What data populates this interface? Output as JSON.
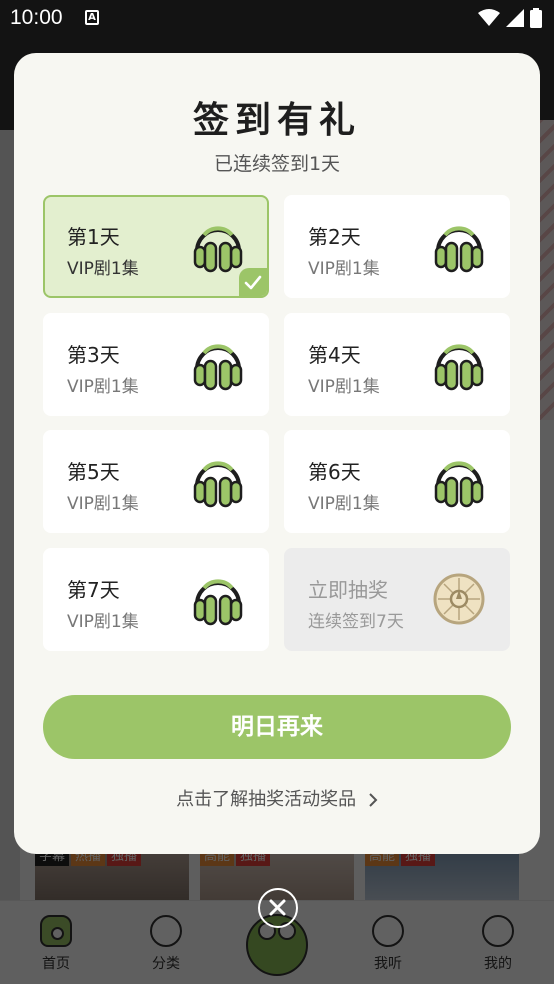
{
  "status_bar": {
    "time": "10:00",
    "notification_icon": "a-box-icon",
    "icons": [
      "wifi-icon",
      "signal-icon",
      "battery-icon"
    ]
  },
  "background": {
    "posters": [
      {
        "tags": [
          "字幕",
          "热播",
          "独播"
        ]
      },
      {
        "tags": [
          "高能",
          "独播"
        ]
      },
      {
        "tags": [
          "高能",
          "独播"
        ]
      }
    ],
    "tabbar": {
      "tabs": [
        {
          "label": "首页",
          "icon": "home-icon",
          "active": true
        },
        {
          "label": "分类",
          "icon": "category-icon"
        },
        {
          "label": "",
          "icon": "frog-icon"
        },
        {
          "label": "我听",
          "icon": "listen-icon"
        },
        {
          "label": "我的",
          "icon": "profile-icon"
        }
      ]
    }
  },
  "dialog": {
    "title": "签到有礼",
    "subtitle": "已连续签到1天",
    "accent_color": "#9cc568",
    "days": [
      {
        "day": "第1天",
        "reward": "VIP剧1集",
        "checked": true,
        "icon": "headphones-icon"
      },
      {
        "day": "第2天",
        "reward": "VIP剧1集",
        "checked": false,
        "icon": "headphones-icon"
      },
      {
        "day": "第3天",
        "reward": "VIP剧1集",
        "checked": false,
        "icon": "headphones-icon"
      },
      {
        "day": "第4天",
        "reward": "VIP剧1集",
        "checked": false,
        "icon": "headphones-icon"
      },
      {
        "day": "第5天",
        "reward": "VIP剧1集",
        "checked": false,
        "icon": "headphones-icon"
      },
      {
        "day": "第6天",
        "reward": "VIP剧1集",
        "checked": false,
        "icon": "headphones-icon"
      },
      {
        "day": "第7天",
        "reward": "VIP剧1集",
        "checked": false,
        "icon": "headphones-icon"
      }
    ],
    "lottery": {
      "title": "立即抽奖",
      "desc": "连续签到7天",
      "icon": "lottery-wheel-icon"
    },
    "main_button": "明日再来",
    "rules_link": "点击了解抽奖活动奖品",
    "close_icon": "close-icon"
  }
}
